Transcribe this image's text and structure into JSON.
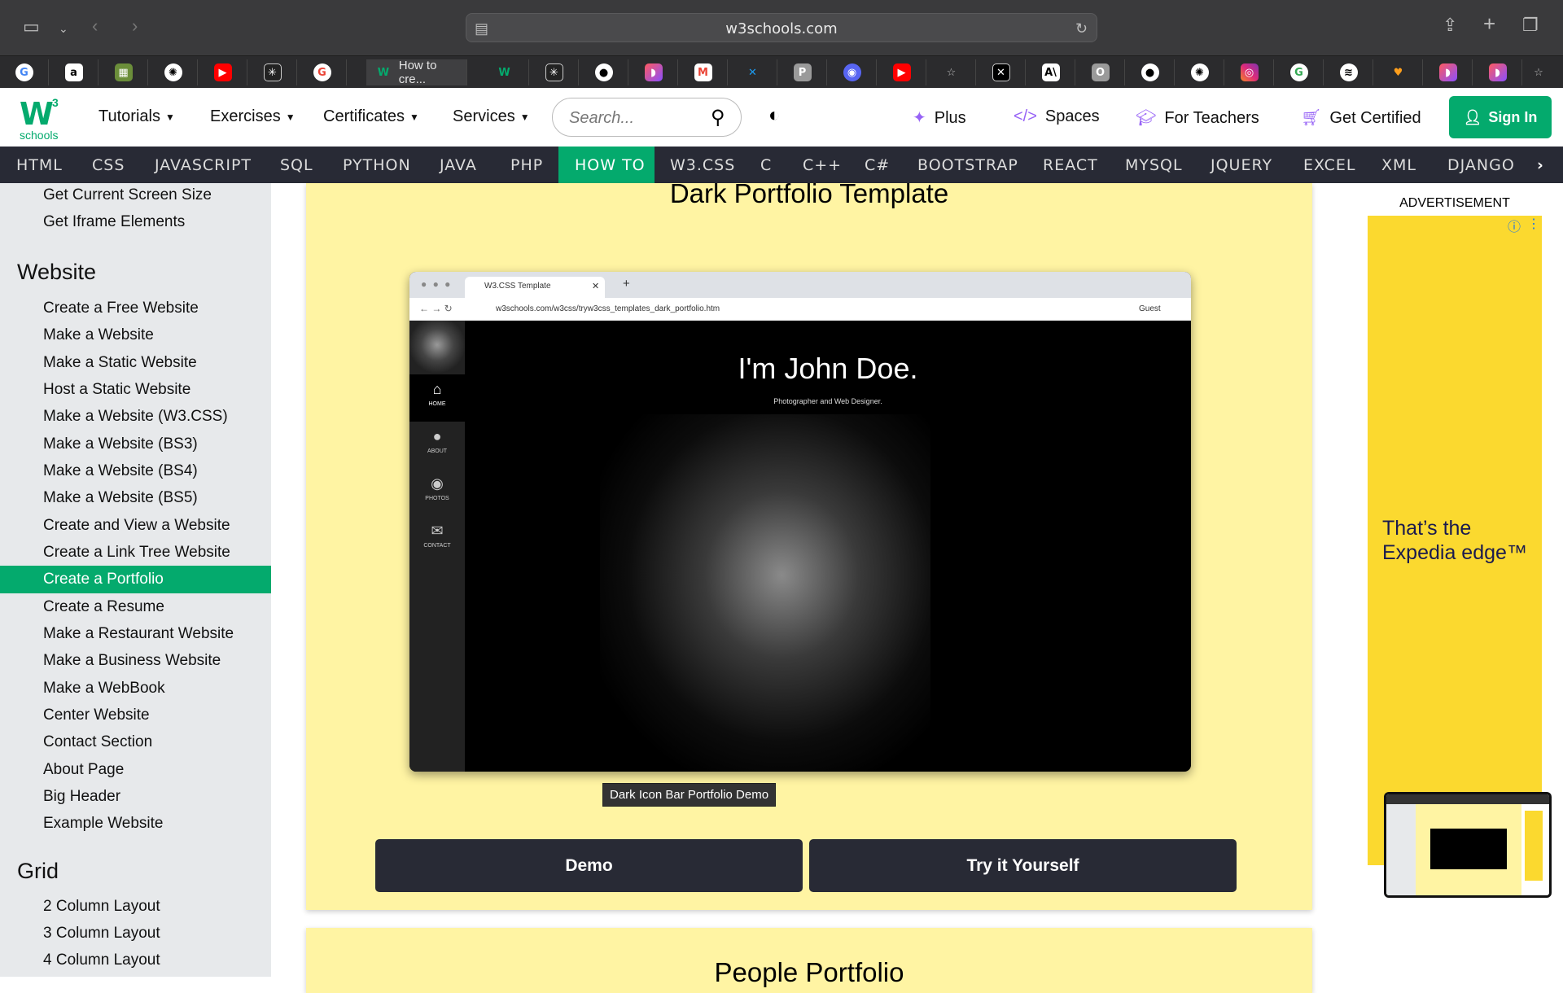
{
  "browser": {
    "url": "w3schools.com",
    "active_tab_title": "How to cre...",
    "tab_favicons": [
      "google",
      "amazon",
      "calculator",
      "chatgpt",
      "youtube",
      "perplexity",
      "google",
      "w3schools",
      "w3schools",
      "perplexity",
      "github",
      "arc",
      "gmail",
      "x-blue",
      "p-app",
      "discord",
      "youtube",
      "star",
      "x",
      "anthropic",
      "o-app",
      "github",
      "chatgpt",
      "instagram",
      "google",
      "spotify",
      "heart",
      "arc",
      "arc",
      "star"
    ]
  },
  "w3nav": {
    "logo_sup": "3",
    "logo_text": "schools",
    "tutorials": "Tutorials",
    "exercises": "Exercises",
    "certificates": "Certificates",
    "services": "Services",
    "search_placeholder": "Search...",
    "plus": "Plus",
    "spaces": "Spaces",
    "for_teachers": "For Teachers",
    "get_certified": "Get Certified",
    "sign_in": "Sign In"
  },
  "menu": [
    "HTML",
    "CSS",
    "JAVASCRIPT",
    "SQL",
    "PYTHON",
    "JAVA",
    "PHP",
    "HOW TO",
    "W3.CSS",
    "C",
    "C++",
    "C#",
    "BOOTSTRAP",
    "REACT",
    "MYSQL",
    "JQUERY",
    "EXCEL",
    "XML",
    "DJANGO"
  ],
  "sidebar": {
    "top_items": [
      "Get Current Screen Size",
      "Get Iframe Elements"
    ],
    "website_heading": "Website",
    "website_items": [
      "Create a Free Website",
      "Make a Website",
      "Make a Static Website",
      "Host a Static Website",
      "Make a Website (W3.CSS)",
      "Make a Website (BS3)",
      "Make a Website (BS4)",
      "Make a Website (BS5)",
      "Create and View a Website",
      "Create a Link Tree Website",
      "Create a Portfolio",
      "Create a Resume",
      "Make a Restaurant Website",
      "Make a Business Website",
      "Make a WebBook",
      "Center Website",
      "Contact Section",
      "About Page",
      "Big Header",
      "Example Website"
    ],
    "active_item": "Create a Portfolio",
    "grid_heading": "Grid",
    "grid_items": [
      "2 Column Layout",
      "3 Column Layout",
      "4 Column Layout"
    ]
  },
  "card": {
    "title": "Dark Portfolio Template",
    "mock_tab": "W3.CSS Template",
    "mock_url": "w3schools.com/w3css/tryw3css_templates_dark_portfolio.htm",
    "mock_guest": "Guest",
    "mock_heading": "I'm John Doe.",
    "mock_sub": "Photographer and Web Designer.",
    "mock_nav": [
      "HOME",
      "ABOUT",
      "PHOTOS",
      "CONTACT"
    ],
    "caption": "Dark Icon Bar Portfolio Demo",
    "demo": "Demo",
    "try": "Try it Yourself"
  },
  "card2_title": "People Portfolio",
  "ad": {
    "label": "ADVERTISEMENT",
    "line1": "That’s the",
    "line2": "Expedia edge™"
  }
}
